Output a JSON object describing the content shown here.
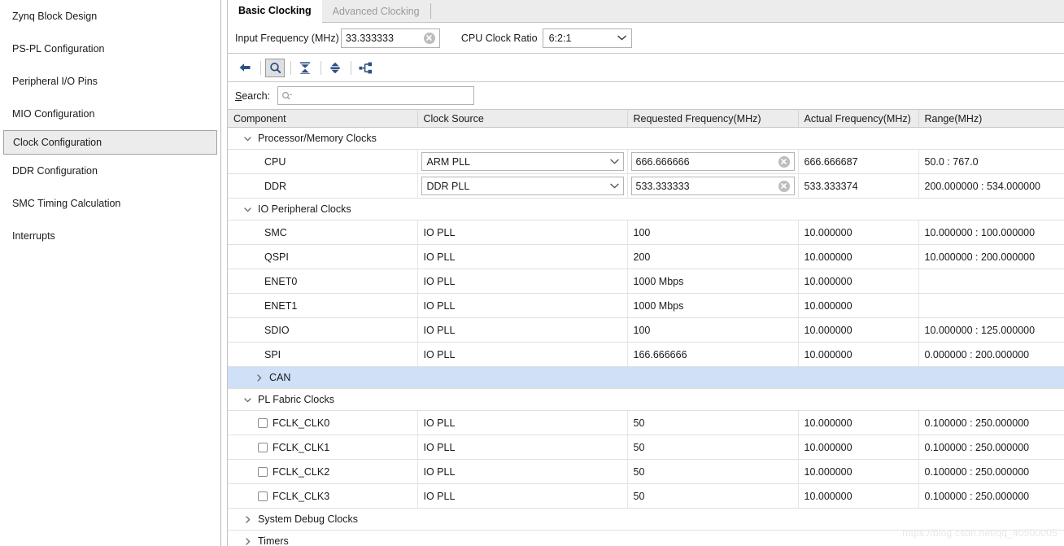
{
  "sidebar": {
    "items": [
      {
        "label": "Zynq Block Design",
        "selected": false
      },
      {
        "label": "PS-PL Configuration",
        "selected": false
      },
      {
        "label": "Peripheral I/O Pins",
        "selected": false
      },
      {
        "label": "MIO Configuration",
        "selected": false
      },
      {
        "label": "Clock Configuration",
        "selected": true
      },
      {
        "label": "DDR Configuration",
        "selected": false
      },
      {
        "label": "SMC Timing Calculation",
        "selected": false
      },
      {
        "label": "Interrupts",
        "selected": false
      }
    ]
  },
  "tabs": [
    {
      "label": "Basic Clocking",
      "active": true
    },
    {
      "label": "Advanced Clocking",
      "active": false
    }
  ],
  "form": {
    "input_frequency_label": "Input Frequency (MHz)",
    "input_frequency_value": "33.333333",
    "cpu_clock_ratio_label": "CPU Clock Ratio",
    "cpu_clock_ratio_value": "6:2:1"
  },
  "toolbar": {
    "buttons": [
      {
        "name": "back-arrow-icon",
        "title": "Back",
        "active": false
      },
      {
        "name": "search-icon",
        "title": "Search",
        "active": true
      },
      {
        "name": "collapse-all-icon",
        "title": "Collapse All",
        "active": false
      },
      {
        "name": "expand-all-icon",
        "title": "Expand All",
        "active": false
      },
      {
        "name": "hierarchy-icon",
        "title": "Hierarchy",
        "active": false
      }
    ]
  },
  "search": {
    "label_prefix": "S",
    "label_rest": "earch:",
    "value": "",
    "placeholder": ""
  },
  "table": {
    "columns": [
      "Component",
      "Clock Source",
      "Requested Frequency(MHz)",
      "Actual Frequency(MHz)",
      "Range(MHz)"
    ],
    "rows": [
      {
        "kind": "group",
        "expanded": true,
        "indent": 1,
        "label": "Processor/Memory Clocks",
        "highlight": false
      },
      {
        "kind": "editrow",
        "component": "CPU",
        "source": "ARM PLL",
        "requested": "666.666666",
        "actual": "666.666687",
        "range": "50.0 : 767.0"
      },
      {
        "kind": "editrow",
        "component": "DDR",
        "source": "DDR PLL",
        "requested": "533.333333",
        "actual": "533.333374",
        "range": "200.000000 : 534.000000"
      },
      {
        "kind": "group",
        "expanded": true,
        "indent": 1,
        "label": "IO Peripheral Clocks",
        "highlight": false
      },
      {
        "kind": "row",
        "component": "SMC",
        "source": "IO PLL",
        "requested": "100",
        "actual": "10.000000",
        "range": "10.000000 : 100.000000"
      },
      {
        "kind": "row",
        "component": "QSPI",
        "source": "IO PLL",
        "requested": "200",
        "actual": "10.000000",
        "range": "10.000000 : 200.000000"
      },
      {
        "kind": "row",
        "component": "ENET0",
        "source": "IO PLL",
        "requested": "1000 Mbps",
        "actual": "10.000000",
        "range": ""
      },
      {
        "kind": "row",
        "component": "ENET1",
        "source": "IO PLL",
        "requested": "1000 Mbps",
        "actual": "10.000000",
        "range": ""
      },
      {
        "kind": "row",
        "component": "SDIO",
        "source": "IO PLL",
        "requested": "100",
        "actual": "10.000000",
        "range": "10.000000 : 125.000000"
      },
      {
        "kind": "row",
        "component": "SPI",
        "source": "IO PLL",
        "requested": "166.666666",
        "actual": "10.000000",
        "range": "0.000000 : 200.000000"
      },
      {
        "kind": "group",
        "expanded": false,
        "indent": 2,
        "label": "CAN",
        "highlight": true
      },
      {
        "kind": "group",
        "expanded": true,
        "indent": 1,
        "label": "PL Fabric Clocks",
        "highlight": false
      },
      {
        "kind": "checkrow",
        "checked": false,
        "component": "FCLK_CLK0",
        "source": "IO PLL",
        "requested": "50",
        "actual": "10.000000",
        "range": "0.100000 : 250.000000"
      },
      {
        "kind": "checkrow",
        "checked": false,
        "component": "FCLK_CLK1",
        "source": "IO PLL",
        "requested": "50",
        "actual": "10.000000",
        "range": "0.100000 : 250.000000"
      },
      {
        "kind": "checkrow",
        "checked": false,
        "component": "FCLK_CLK2",
        "source": "IO PLL",
        "requested": "50",
        "actual": "10.000000",
        "range": "0.100000 : 250.000000"
      },
      {
        "kind": "checkrow",
        "checked": false,
        "component": "FCLK_CLK3",
        "source": "IO PLL",
        "requested": "50",
        "actual": "10.000000",
        "range": "0.100000 : 250.000000"
      },
      {
        "kind": "group",
        "expanded": false,
        "indent": 1,
        "label": "System Debug Clocks",
        "highlight": false
      },
      {
        "kind": "group",
        "expanded": false,
        "indent": 1,
        "label": "Timers",
        "highlight": false
      }
    ]
  },
  "watermark": "https://blog.csdn.net/qq_40500005",
  "colors": {
    "accent": "#2f4f82",
    "selection": "#cfe0f7",
    "header_bg": "#ececec"
  }
}
